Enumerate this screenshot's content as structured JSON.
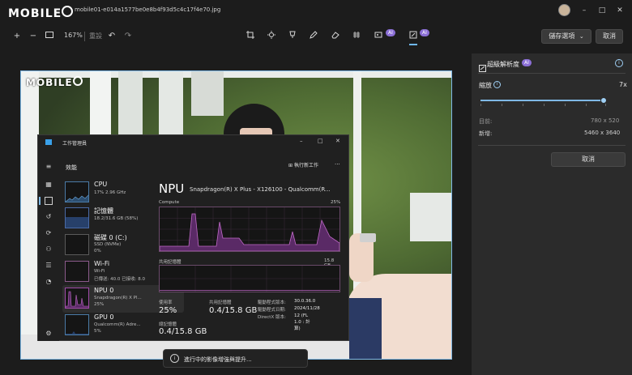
{
  "titlebar": {
    "filename": "mobile01-e014a1577be0e8b4f93d5c4c17f4e70.jpg",
    "logo_text": "MOBILE01",
    "minimize": "–",
    "maximize": "□",
    "close": "✕"
  },
  "toolbar": {
    "zoom_in_icon": "+",
    "zoom_out_icon": "−",
    "zoom_level": "167%",
    "reset_label": "重設",
    "undo_icon": "↶",
    "redo_icon": "↷",
    "ai_badge": "AI",
    "save_options_label": "儲存選項",
    "cancel_label": "取消"
  },
  "photo": {
    "watermark": "MOBILE01"
  },
  "task_manager": {
    "title": "工作管理員",
    "section_title": "效能",
    "run_new_task": "執行新工作",
    "more": "···",
    "items": [
      {
        "name": "CPU",
        "sub1": "17%  2.96 GHz",
        "sub2": ""
      },
      {
        "name": "記憶體",
        "sub1": "18.2/31.6 GB (58%)",
        "sub2": ""
      },
      {
        "name": "磁碟 0 (C:)",
        "sub1": "SSD (NVMe)",
        "sub2": "0%"
      },
      {
        "name": "Wi-Fi",
        "sub1": "Wi-Fi",
        "sub2": "已傳送: 40.0  已接收: 8.0"
      },
      {
        "name": "NPU 0",
        "sub1": "Snapdragon(R) X Pl...",
        "sub2": "25%"
      },
      {
        "name": "GPU 0",
        "sub1": "Qualcomm(R) Adre...",
        "sub2": "5%"
      }
    ],
    "detail": {
      "heading": "NPU",
      "model": "Snapdragon(R) X Plus - X126100 - Qualcomm(R...",
      "graph1_label": "Compute",
      "graph1_max": "25%",
      "graph2_label": "共用記憶體",
      "graph2_max": "15.8 GB",
      "usage_label": "使用率",
      "usage_value": "25%",
      "shared_mem_label": "共用記憶體",
      "shared_mem_value": "0.4/15.8 GB",
      "driver_version_label": "驅動程式版本:",
      "driver_version_value": "30.0.36.0",
      "driver_date_label": "驅動程式日期:",
      "driver_date_value": "2024/11/28",
      "directx_label": "DirectX 版本:",
      "directx_value": "12 (FL 1.0 : 計算)",
      "npu_mem_label": "總記憶體",
      "npu_mem_value": "0.4/15.8 GB"
    }
  },
  "panel": {
    "title": "超級解析度",
    "ai_badge": "AI",
    "info_icon": "i",
    "scale_label": "縮放",
    "scale_value": "7x",
    "slider_fraction": 0.98,
    "current_label": "目前:",
    "current_value": "780 x 520",
    "new_label": "新增:",
    "new_value": "5460 x 3640",
    "cancel_label": "取消"
  },
  "toast": {
    "text": "進行中的影像增強與提升...",
    "icon": "i"
  },
  "colors": {
    "accent": "#7fb9e6",
    "ai_badge": "#8b6fd6",
    "npu_graph": "#a04aa8"
  }
}
